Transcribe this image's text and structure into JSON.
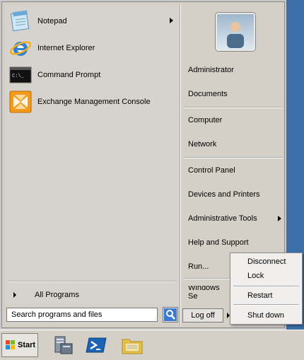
{
  "programs": [
    {
      "label": "Notepad",
      "has_submenu": true
    },
    {
      "label": "Internet Explorer",
      "has_submenu": false
    },
    {
      "label": "Command Prompt",
      "has_submenu": false,
      "icon_text": "C:\\_"
    },
    {
      "label": "Exchange Management Console",
      "has_submenu": false
    }
  ],
  "all_programs": "All Programs",
  "search": {
    "placeholder": "Search programs and files"
  },
  "right_items": [
    {
      "label": "Administrator"
    },
    {
      "label": "Documents"
    },
    {
      "label": "Computer"
    },
    {
      "label": "Network"
    },
    {
      "label": "Control Panel"
    },
    {
      "label": "Devices and Printers"
    },
    {
      "label": "Administrative Tools",
      "has_submenu": true
    },
    {
      "label": "Help and Support"
    },
    {
      "label": "Run..."
    },
    {
      "label": "Windows Se"
    }
  ],
  "logoff": "Log off",
  "shutdown_menu": [
    {
      "label": "Disconnect"
    },
    {
      "label": "Lock"
    },
    {
      "label": "Restart"
    },
    {
      "label": "Shut down"
    }
  ],
  "taskbar": {
    "start_label": "Start"
  },
  "colors": {
    "desktop": "#3c6fa8",
    "menu": "#d4d0c8"
  }
}
